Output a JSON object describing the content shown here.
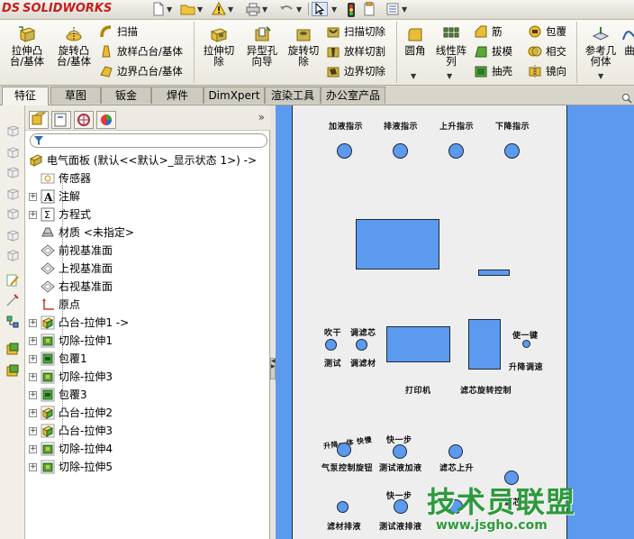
{
  "app": {
    "logo_ds": "DS",
    "logo_text": "SOLIDWORKS"
  },
  "ribbon": {
    "extrude_boss": "拉伸凸\n台/基体",
    "revolve_boss": "旋转凸\n台/基体",
    "sweep": "扫描",
    "loft_boss": "放样凸台/基体",
    "boundary_boss": "边界凸台/基体",
    "extrude_cut": "拉伸切\n除",
    "hole_wizard": "异型孔\n向导",
    "revolve_cut": "旋转切\n除",
    "swept_cut": "扫描切除",
    "loft_cut": "放样切割",
    "boundary_cut": "边界切除",
    "fillet": "圆角",
    "linear_pattern": "线性阵\n列",
    "rib": "筋",
    "draft": "拔模",
    "shell": "抽壳",
    "wrap": "包覆",
    "intersect": "相交",
    "mirror": "镜向",
    "ref_geometry": "参考几\n何体",
    "curves": "曲"
  },
  "tabs": [
    "特征",
    "草图",
    "钣金",
    "焊件",
    "DimXpert",
    "渲染工具",
    "办公室产品"
  ],
  "tree": {
    "root": "电气面板  (默认<<默认>_显示状态 1>) ->",
    "items": [
      {
        "label": "传感器",
        "icon": "sensor-icon",
        "expandable": false
      },
      {
        "label": "注解",
        "icon": "annotation-icon",
        "expandable": true
      },
      {
        "label": "方程式",
        "icon": "equation-icon",
        "expandable": true
      },
      {
        "label": "材质 <未指定>",
        "icon": "material-icon",
        "expandable": false
      },
      {
        "label": "前视基准面",
        "icon": "plane-icon",
        "expandable": false
      },
      {
        "label": "上视基准面",
        "icon": "plane-icon",
        "expandable": false
      },
      {
        "label": "右视基准面",
        "icon": "plane-icon",
        "expandable": false
      },
      {
        "label": "原点",
        "icon": "origin-icon",
        "expandable": false
      },
      {
        "label": "凸台-拉伸1 ->",
        "icon": "extrude-boss-icon",
        "expandable": true
      },
      {
        "label": "切除-拉伸1",
        "icon": "extrude-cut-icon",
        "expandable": true
      },
      {
        "label": "包覆1",
        "icon": "wrap-icon",
        "expandable": true
      },
      {
        "label": "切除-拉伸3",
        "icon": "extrude-cut-icon",
        "expandable": true
      },
      {
        "label": "包覆3",
        "icon": "wrap-icon",
        "expandable": true
      },
      {
        "label": "凸台-拉伸2",
        "icon": "extrude-boss-icon",
        "expandable": true
      },
      {
        "label": "凸台-拉伸3",
        "icon": "extrude-boss-icon",
        "expandable": true
      },
      {
        "label": "切除-拉伸4",
        "icon": "extrude-cut-icon",
        "expandable": true
      },
      {
        "label": "切除-拉伸5",
        "icon": "extrude-cut-icon",
        "expandable": true
      }
    ]
  },
  "panel": {
    "top_labels": [
      "加液指示",
      "排液指示",
      "上升指示",
      "下降指示"
    ],
    "blow_dry": "吹干",
    "filter_adjust": "调滤芯",
    "test": "测试",
    "adjust_filter_material": "调滤材",
    "one_key": "使一键",
    "lift_adjust": "升降调速",
    "printer": "打印机",
    "filter_rotate_control": "滤芯旋转控制",
    "tilt_label": "升降一体 快慢",
    "air_pump_control": "气泵控制旋钮",
    "one_step_1": "快一步",
    "test_liquid_add": "测试液加液",
    "filter_up": "滤芯上升",
    "one_step_2": "快一步",
    "filter_material_drain": "滤材排液",
    "test_liquid_drain": "测试液排液",
    "filter_down": "滤芯"
  },
  "watermark": {
    "text": "技术员联盟",
    "url": "www.jsgho.com"
  }
}
